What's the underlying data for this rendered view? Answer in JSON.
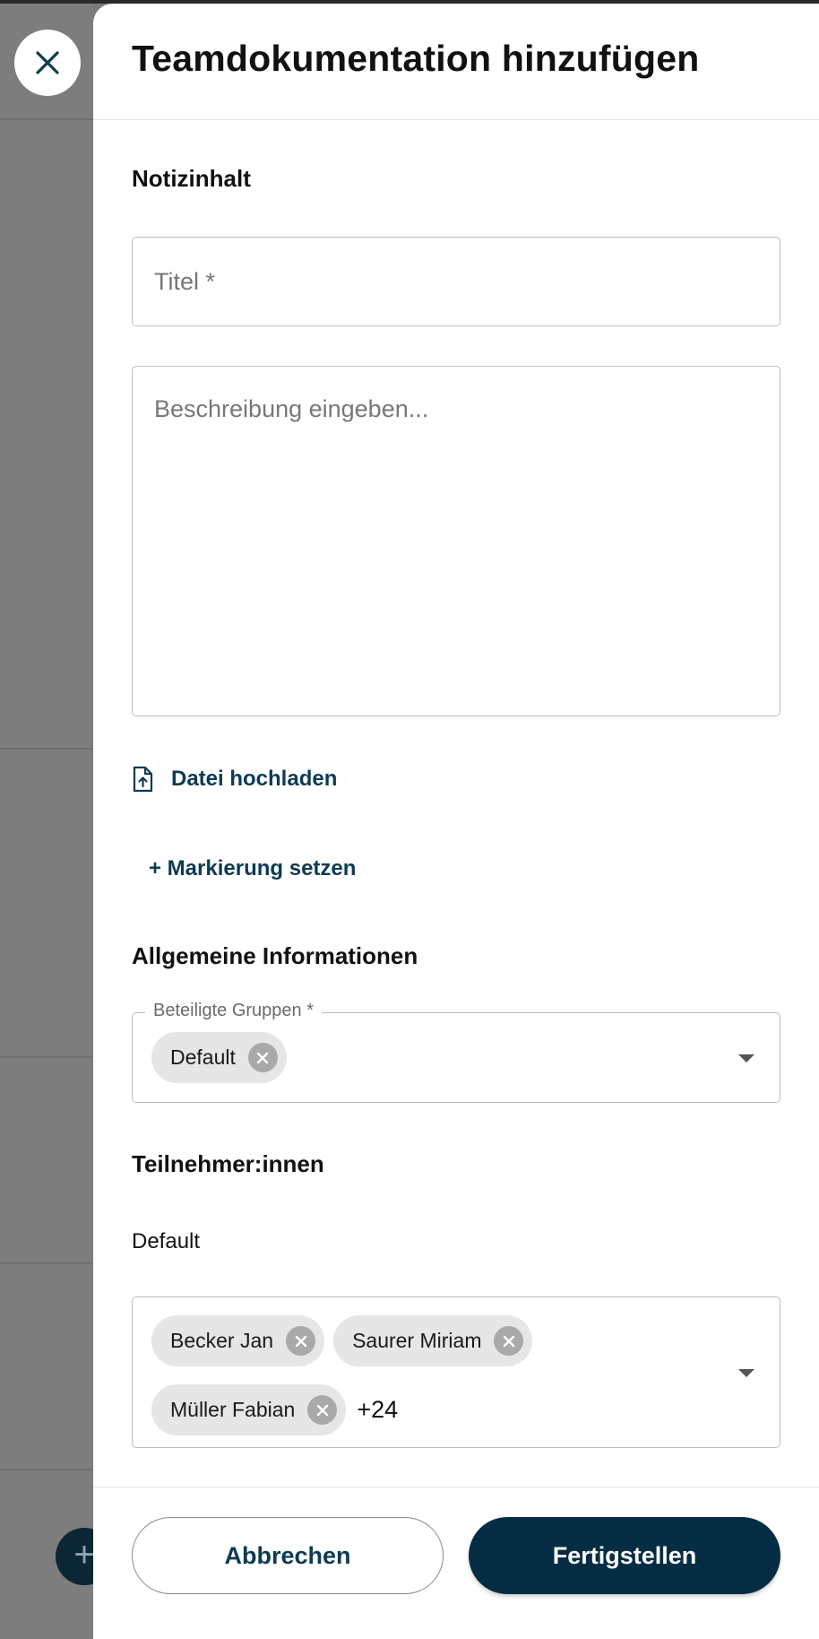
{
  "dialog": {
    "title": "Teamdokumentation hinzufügen",
    "close_icon": "close-icon"
  },
  "note_content": {
    "heading": "Notizinhalt",
    "title_placeholder": "Titel *",
    "title_value": "",
    "description_placeholder": "Beschreibung eingeben...",
    "description_value": ""
  },
  "upload": {
    "label": "Datei hochladen",
    "icon": "file-upload-icon"
  },
  "marking": {
    "label": "+ Markierung setzen"
  },
  "general_info": {
    "heading": "Allgemeine Informationen",
    "groups_label": "Beteiligte Gruppen *",
    "groups_selected": [
      "Default"
    ]
  },
  "participants": {
    "heading": "Teilnehmer:innen",
    "group_name": "Default",
    "selected": [
      "Becker Jan",
      "Saurer Miriam",
      "Müller Fabian"
    ],
    "more_count": "+24"
  },
  "footer": {
    "cancel_label": "Abbrechen",
    "finish_label": "Fertigstellen"
  },
  "colors": {
    "primary": "#042d43",
    "link": "#0d3b52",
    "chip_bg": "#e6e6e6",
    "overlay": "#7d7d7d"
  }
}
